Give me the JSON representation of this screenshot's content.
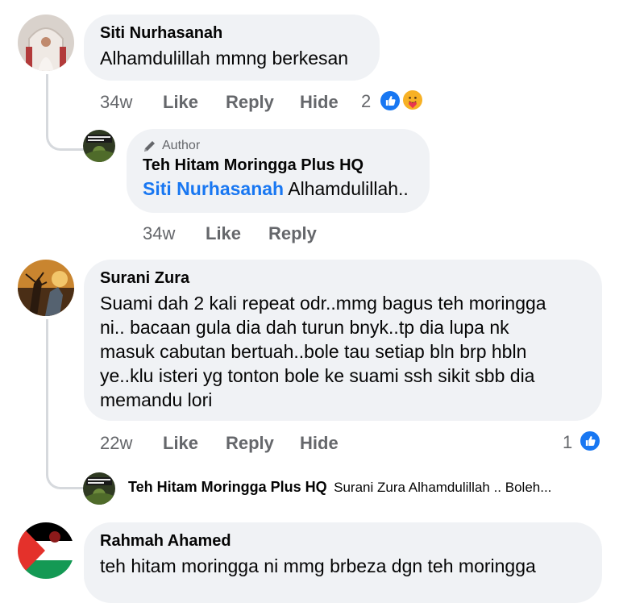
{
  "comments": [
    {
      "author": "Siti Nurhasanah",
      "text": "Alhamdulillah mmng berkesan",
      "time": "34w",
      "like": "Like",
      "reply": "Reply",
      "hide": "Hide",
      "reaction_count": "2",
      "reactions": [
        "like-icon",
        "care-icon"
      ],
      "reply_item": {
        "badge_icon": "pencil-icon",
        "badge": "Author",
        "author": "Teh Hitam Moringga Plus HQ",
        "mention": "Siti Nurhasanah",
        "text": "Alhamdulillah..",
        "time": "34w",
        "like": "Like",
        "reply": "Reply"
      }
    },
    {
      "author": "Surani Zura",
      "text_lines": [
        "Suami dah 2 kali repeat odr..mmg bagus teh moringga",
        "ni.. bacaan gula dia dah turun bnyk..tp dia lupa nk",
        "masuk cabutan bertuah..bole tau setiap bln brp hbln",
        "ye..klu isteri yg tonton bole ke suami ssh sikit sbb dia",
        "memandu lori"
      ],
      "time": "22w",
      "like": "Like",
      "reply": "Reply",
      "hide": "Hide",
      "reaction_count": "1",
      "reactions": [
        "like-icon"
      ],
      "reply_preview": {
        "author": "Teh Hitam Moringga Plus HQ",
        "text": "Surani Zura Alhamdulillah .. Boleh..."
      }
    },
    {
      "author": "Rahmah Ahamed",
      "text": "teh hitam moringga ni mmg brbeza dgn teh moringga"
    }
  ],
  "colors": {
    "bubble": "#f0f2f5",
    "meta_text": "#65676b",
    "mention": "#1877f2",
    "like_blue": "#1877f2"
  }
}
